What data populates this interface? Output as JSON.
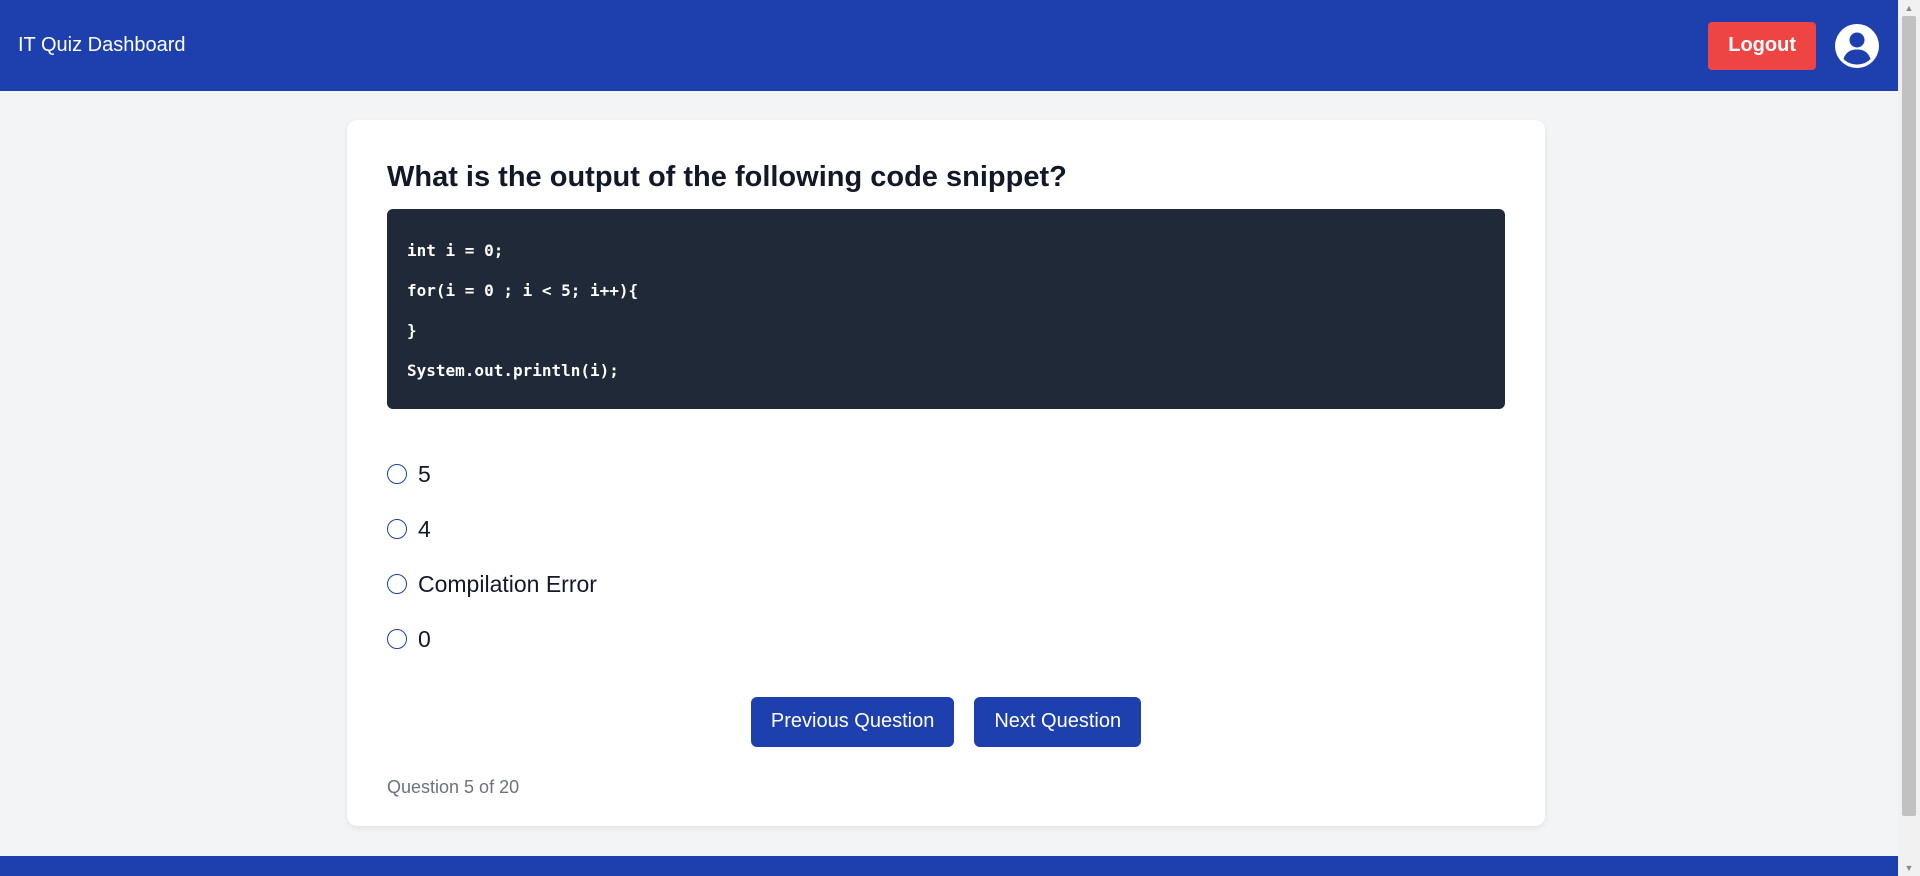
{
  "header": {
    "title": "IT Quiz Dashboard",
    "logout_label": "Logout",
    "avatar_icon": "user-circle-icon"
  },
  "quiz": {
    "question": "What is the output of the following code snippet?",
    "code_lines": [
      "int i = 0;",
      "for(i = 0 ; i < 5; i++){",
      "}",
      "System.out.println(i);"
    ],
    "options": [
      "5",
      "4",
      "Compilation Error",
      "0"
    ],
    "selected_option": null,
    "prev_label": "Previous Question",
    "next_label": "Next Question",
    "progress": "Question 5 of 20"
  },
  "colors": {
    "primary": "#1e40af",
    "danger": "#ef4444",
    "code_bg": "#1f2937",
    "page_bg": "#f3f4f6"
  }
}
